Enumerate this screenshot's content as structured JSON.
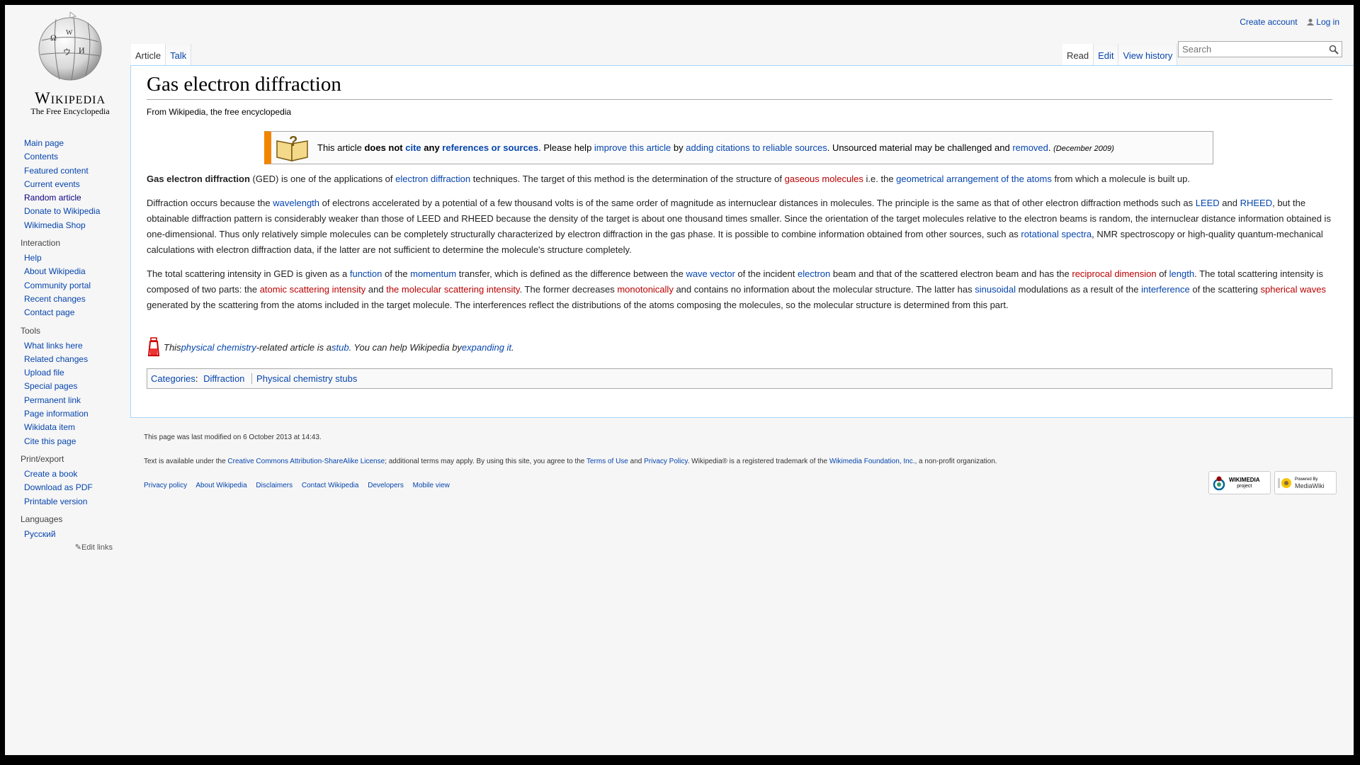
{
  "logo": {
    "wordmark": "Wikipedia",
    "tagline": "The Free Encyclopedia"
  },
  "personal": {
    "create_account": "Create account",
    "log_in": "Log in"
  },
  "tabs": {
    "left": [
      "Article",
      "Talk"
    ],
    "right": [
      "Read",
      "Edit",
      "View history"
    ]
  },
  "search": {
    "placeholder": "Search"
  },
  "sidebar": {
    "navigation": [
      "Main page",
      "Contents",
      "Featured content",
      "Current events",
      "Random article",
      "Donate to Wikipedia",
      "Wikimedia Shop"
    ],
    "interaction": {
      "heading": "Interaction",
      "items": [
        "Help",
        "About Wikipedia",
        "Community portal",
        "Recent changes",
        "Contact page"
      ]
    },
    "tools": {
      "heading": "Tools",
      "items": [
        "What links here",
        "Related changes",
        "Upload file",
        "Special pages",
        "Permanent link",
        "Page information",
        "Wikidata item",
        "Cite this page"
      ]
    },
    "print": {
      "heading": "Print/export",
      "items": [
        "Create a book",
        "Download as PDF",
        "Printable version"
      ]
    },
    "languages": {
      "heading": "Languages",
      "items": [
        "Русский"
      ]
    },
    "edit_links": "Edit links"
  },
  "article": {
    "title": "Gas electron diffraction",
    "tagline": "From Wikipedia, the free encyclopedia",
    "ambox": {
      "t1": "This article ",
      "t2": "does not ",
      "t3": "cite",
      "t4": " any ",
      "t5": "references or sources",
      "t6": ". Please help ",
      "t7": "improve this article",
      "t8": " by ",
      "t9": "adding citations to reliable sources",
      "t10": ". Unsourced material may be challenged and ",
      "t11": "removed",
      "t12": ".",
      "date": "(December 2009)"
    },
    "p1": {
      "b": "Gas electron diffraction",
      "a1": " (GED) is one of the applications of ",
      "l1": "electron diffraction",
      "a2": " techniques. The target of this method is the determination of the structure of ",
      "l2": "gaseous molecules",
      "a3": " i.e. the ",
      "l3": "geometrical arrangement of the atoms",
      "a4": " from which a molecule is built up."
    },
    "p2": {
      "a1": "Diffraction occurs because the ",
      "l1": "wavelength",
      "a2": " of electrons accelerated by a potential of a few thousand volts is of the same order of magnitude as internuclear distances in molecules. The principle is the same as that of other electron diffraction methods such as ",
      "l2": "LEED",
      "a3": " and ",
      "l3": "RHEED",
      "a4": ", but the obtainable diffraction pattern is considerably weaker than those of LEED and RHEED because the density of the target is about one thousand times smaller. Since the orientation of the target molecules relative to the electron beams is random, the internuclear distance information obtained is one-dimensional. Thus only relatively simple molecules can be completely structurally characterized by electron diffraction in the gas phase. It is possible to combine information obtained from other sources, such as ",
      "l4": "rotational spectra",
      "a5": ", NMR spectroscopy or high-quality quantum-mechanical calculations with electron diffraction data, if the latter are not sufficient to determine the molecule's structure completely."
    },
    "p3": {
      "a1": "The total scattering intensity in GED is given as a ",
      "l1": "function",
      "a2": " of the ",
      "l2": "momentum",
      "a3": " transfer, which is defined as the difference between the ",
      "l3": "wave vector",
      "a4": " of the incident ",
      "l4": "electron",
      "a5": " beam and that of the scattered electron beam and has the ",
      "l5": "reciprocal dimension",
      "a6": " of ",
      "l6": "length",
      "a7": ". The total scattering intensity is composed of two parts: the ",
      "l7": "atomic scattering intensity",
      "a8": " and ",
      "l8": "the molecular scattering intensity",
      "a9": ". The former decreases ",
      "l9": "monotonically",
      "a10": " and contains no information about the molecular structure. The latter has ",
      "l10": "sinusoidal",
      "a11": " modulations as a result of the ",
      "l11": "interference",
      "a12": " of the scattering ",
      "l12": "spherical waves",
      "a13": " generated by the scattering from the atoms included in the target molecule. The interferences reflect the distributions of the atoms composing the molecules, so the molecular structure is determined from this part."
    },
    "stub": {
      "a1": "This ",
      "l1": "physical chemistry",
      "a2": "-related article is a ",
      "l2": "stub",
      "a3": ". You can help Wikipedia by ",
      "l3": "expanding it",
      "a4": "."
    },
    "categories": {
      "label": "Categories",
      "items": [
        "Diffraction",
        "Physical chemistry stubs"
      ]
    }
  },
  "footer": {
    "modified": "This page was last modified on 6 October 2013 at 14:43.",
    "license": {
      "a1": "Text is available under the ",
      "l1": "Creative Commons Attribution-ShareAlike License",
      "a2": "; additional terms may apply. By using this site, you agree to the ",
      "l2": "Terms of Use",
      "a3": " and ",
      "l3": "Privacy Policy",
      "a4": ". Wikipedia® is a registered trademark of the ",
      "l4": "Wikimedia Foundation, Inc.",
      "a5": ", a non-profit organization."
    },
    "links": [
      "Privacy policy",
      "About Wikipedia",
      "Disclaimers",
      "Contact Wikipedia",
      "Developers",
      "Mobile view"
    ],
    "badges": {
      "wikimedia": "WIKIMEDIA",
      "wikimedia_sub": "project",
      "mediawiki_top": "Powered By",
      "mediawiki": "MediaWiki"
    }
  }
}
